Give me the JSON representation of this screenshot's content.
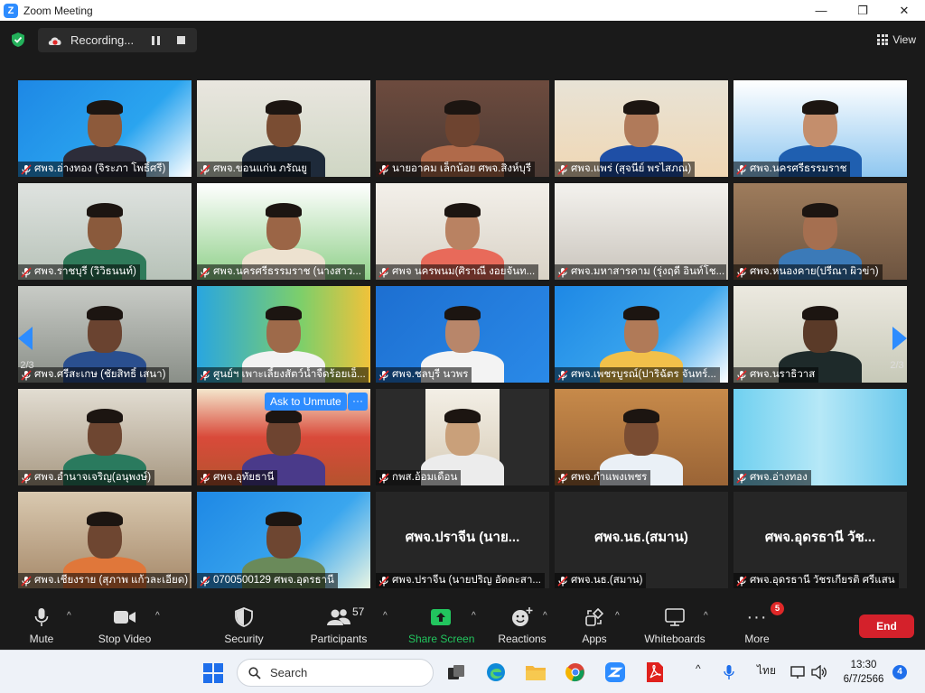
{
  "window": {
    "title": "Zoom Meeting",
    "minimize": "—",
    "restore": "❐",
    "close": "✕"
  },
  "topbar": {
    "recording_label": "Recording...",
    "view_label": "View"
  },
  "tiles": [
    {
      "name": "ศพจ.อ่างทอง (จิระภา โพธิ์ศรี)"
    },
    {
      "name": "ศพจ.ขอนแก่น ภรัณยู"
    },
    {
      "name": "นายอาคม เล็กน้อย ศพจ.สิงห์บุรี"
    },
    {
      "name": "ศพจ.แพร่ (สุจนีย์ พรไสภณ)"
    },
    {
      "name": "ศพจ.นครศรีธรรมราช"
    },
    {
      "name": "ศพจ.ราชบุรี (วิวิธนนท์)"
    },
    {
      "name": "ศพจ.นครศรีธรรมราช (นางสาว..."
    },
    {
      "name": "ศพจ นครพนม(ศิราณี งอยจันท..."
    },
    {
      "name": "ศพจ.มหาสารคาม (รุ่งฤดี อินท์โช..."
    },
    {
      "name": "ศพจ.หนองคาย(ปรีณา ผิวข่า)"
    },
    {
      "name": "ศพจ.ศรีสะเกษ (ชัยสิทธิ์ เสนา)"
    },
    {
      "name": "ศูนย์ฯ เพาะเลี้ยงสัตว์น้ำจืดร้อยเอ็..."
    },
    {
      "name": "ศพจ.ชลบุรี นวพร"
    },
    {
      "name": "ศพจ.เพชรบูรณ์(ปาริฉัตร จันทร์..."
    },
    {
      "name": "ศพจ.นราธิวาส"
    },
    {
      "name": "ศพจ.อำนาจเจริญ(อนุพงษ์)"
    },
    {
      "name": "ศพจ.อุทัยธานี"
    },
    {
      "name": "กพส.อ้อมเดือน"
    },
    {
      "name": "ศพจ.กำแพงเพชร"
    },
    {
      "name": "ศพจ.อ่างทอง"
    },
    {
      "name": "ศพจ.เชียงราย (สุภาพ แก้วละเอียด)"
    },
    {
      "name": "0700500129 ศพจ.อุดรธานี"
    },
    {
      "name": "ศพจ.ปราจีน (นายปริญ อัตตะสา...",
      "display": "ศพจ.ปราจีน (นาย..."
    },
    {
      "name": "ศพจ.นธ.(สมาน)",
      "display": "ศพจ.นธ.(สมาน)"
    },
    {
      "name": "ศพจ.อุดรธานี วัชรเกียรติ ศรีแสน",
      "display": "ศพจ.อุดรธานี วัช..."
    }
  ],
  "overlay": {
    "ask_to_unmute": "Ask to Unmute",
    "more": "···"
  },
  "pager": {
    "left": "2/3",
    "right": "2/3"
  },
  "toolbar": {
    "mute": "Mute",
    "stop_video": "Stop Video",
    "security": "Security",
    "participants": "Participants",
    "participants_count": "57",
    "share_screen": "Share Screen",
    "reactions": "Reactions",
    "apps": "Apps",
    "whiteboards": "Whiteboards",
    "more": "More",
    "more_badge": "5",
    "end": "End",
    "caret": "^"
  },
  "taskbar": {
    "search": "Search",
    "language": "ไทย",
    "time": "13:30",
    "date": "6/7/2566",
    "notifications": "4",
    "chevron": "^"
  },
  "colors": {
    "accent": "#2d8cff",
    "share_green": "#22c55e",
    "end_red": "#d4212b"
  }
}
